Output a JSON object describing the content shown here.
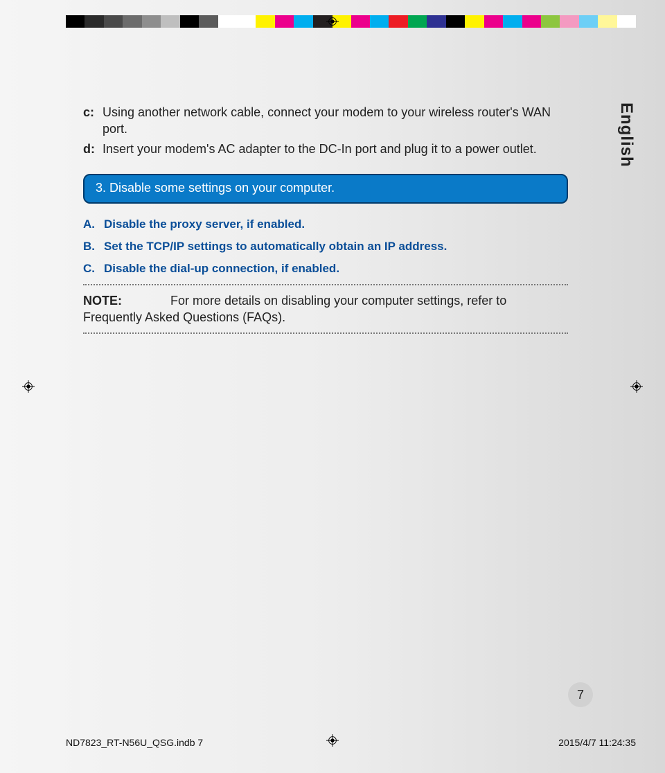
{
  "colorbar": [
    "#000000",
    "#2b2b2b",
    "#4a4a4a",
    "#6c6c6c",
    "#8e8e8e",
    "#bfbfbf",
    "#000000",
    "#5b5b5b",
    "#ffffff",
    "#ffffff",
    "#fff200",
    "#ec008c",
    "#00aeef",
    "#231f20",
    "#fff200",
    "#ec008c",
    "#00aeef",
    "#ed1c24",
    "#00a651",
    "#2e3192",
    "#000000",
    "#fff200",
    "#ec008c",
    "#00aeef",
    "#ec008c",
    "#8dc63f",
    "#f49ac1",
    "#6dcff6",
    "#fff799",
    "#ffffff"
  ],
  "steps": [
    {
      "label": "c:",
      "text": "Using another network cable, connect your modem to your wireless router's WAN port."
    },
    {
      "label": "d:",
      "text": "Insert your modem's AC adapter to the DC-In port and plug it to a power outlet."
    }
  ],
  "box_heading": "3.   Disable some settings on your computer.",
  "subitems": [
    {
      "label": "A.",
      "text": "Disable the proxy server, if enabled."
    },
    {
      "label": "B.",
      "text": "Set the TCP/IP settings to automatically obtain an IP address."
    },
    {
      "label": "C.",
      "text": "Disable the dial-up connection, if enabled."
    }
  ],
  "note": {
    "label": "NOTE:",
    "text": "For more details on disabling your computer settings, refer to Frequently Asked Questions (FAQs)."
  },
  "language_tab": "English",
  "page_number": "7",
  "footer": {
    "left": "ND7823_RT-N56U_QSG.indb   7",
    "right": "2015/4/7   11:24:35"
  }
}
